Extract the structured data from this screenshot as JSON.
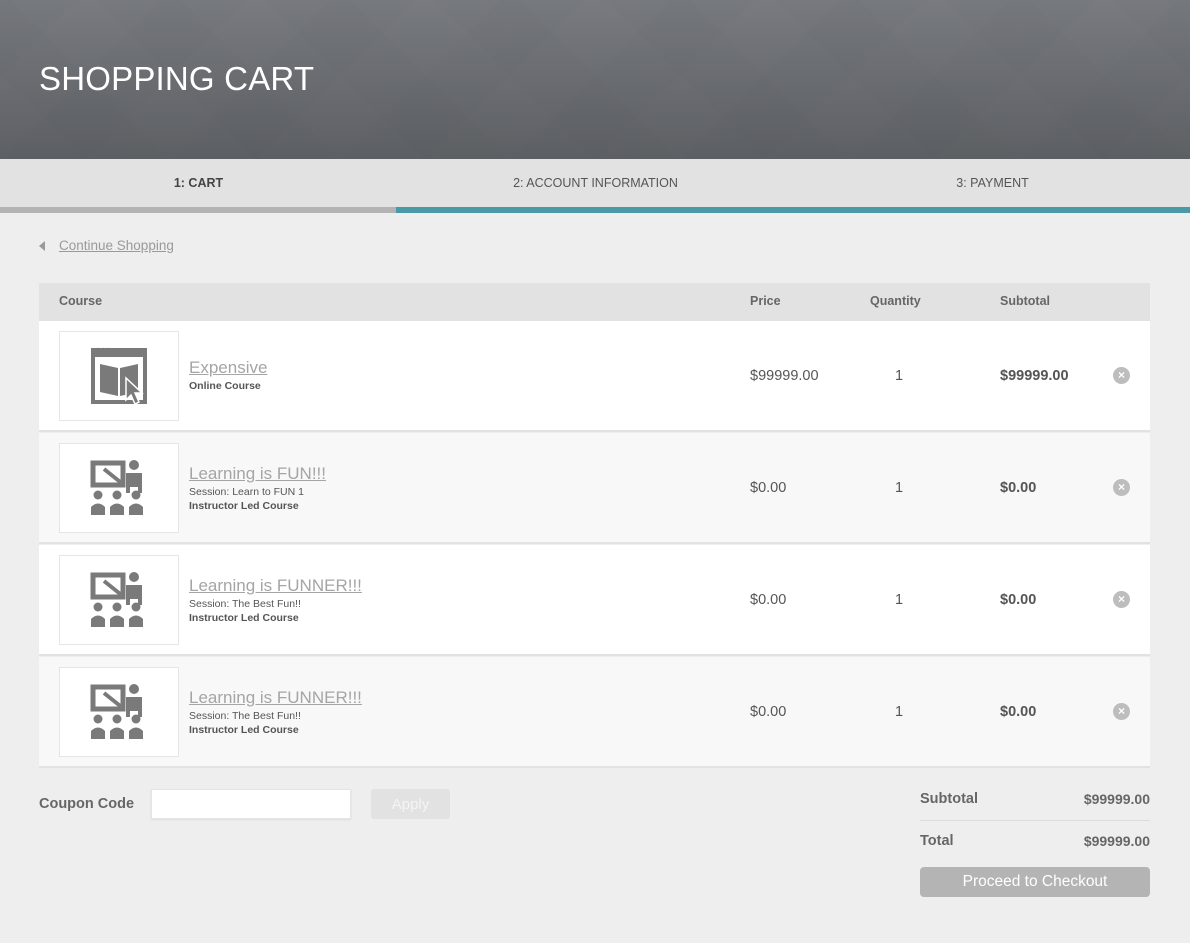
{
  "header": {
    "title": "SHOPPING CART"
  },
  "steps": [
    {
      "label": "1: CART",
      "active": true
    },
    {
      "label": "2: ACCOUNT INFORMATION",
      "active": false
    },
    {
      "label": "3: PAYMENT",
      "active": false
    }
  ],
  "nav": {
    "continue_label": "Continue Shopping"
  },
  "table": {
    "headers": {
      "course": "Course",
      "price": "Price",
      "quantity": "Quantity",
      "subtotal": "Subtotal"
    },
    "rows": [
      {
        "title": "Expensive",
        "session": "",
        "type": "Online Course",
        "icon": "online-course-icon",
        "price": "$99999.00",
        "quantity": "1",
        "subtotal": "$99999.00"
      },
      {
        "title": "Learning is FUN!!!",
        "session": "Session: Learn to FUN 1",
        "type": "Instructor Led Course",
        "icon": "instructor-led-icon",
        "price": "$0.00",
        "quantity": "1",
        "subtotal": "$0.00"
      },
      {
        "title": "Learning is FUNNER!!!",
        "session": "Session: The Best Fun!!",
        "type": "Instructor Led Course",
        "icon": "instructor-led-icon",
        "price": "$0.00",
        "quantity": "1",
        "subtotal": "$0.00"
      },
      {
        "title": "Learning is FUNNER!!!",
        "session": "Session: The Best Fun!!",
        "type": "Instructor Led Course",
        "icon": "instructor-led-icon",
        "price": "$0.00",
        "quantity": "1",
        "subtotal": "$0.00"
      }
    ]
  },
  "coupon": {
    "label": "Coupon Code",
    "value": "",
    "placeholder": "",
    "apply_label": "Apply"
  },
  "summary": {
    "subtotal_label": "Subtotal",
    "subtotal_value": "$99999.00",
    "total_label": "Total",
    "total_value": "$99999.00",
    "checkout_label": "Proceed to Checkout"
  },
  "colors": {
    "accent": "#4a99a6",
    "progress_done": "#b3b3b3",
    "header_bg": "#6a6d71"
  }
}
